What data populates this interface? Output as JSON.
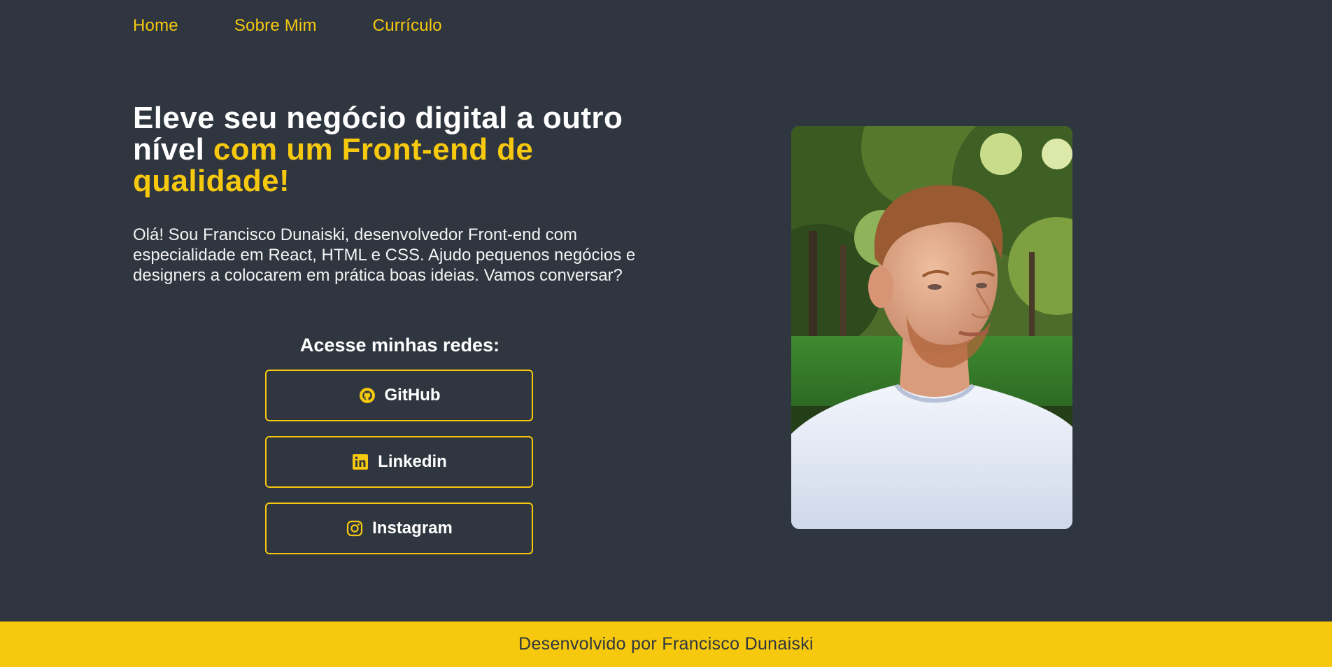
{
  "nav": {
    "items": [
      {
        "label": "Home"
      },
      {
        "label": "Sobre Mim"
      },
      {
        "label": "Currículo"
      }
    ]
  },
  "hero": {
    "title_part1": "Eleve seu negócio digital a outro nível ",
    "title_highlight": "com um Front-end de qualidade!",
    "intro": "Olá! Sou Francisco Dunaiski, desenvolvedor Front-end com especialidade em React, HTML e CSS. Ajudo pequenos negócios e designers a colocarem em prática boas ideias. Vamos conversar?"
  },
  "social": {
    "title": "Acesse minhas redes:",
    "buttons": [
      {
        "label": "GitHub",
        "icon": "github-icon"
      },
      {
        "label": "Linkedin",
        "icon": "linkedin-icon"
      },
      {
        "label": "Instagram",
        "icon": "instagram-icon"
      }
    ]
  },
  "photo": {
    "alt": "portrait-photo"
  },
  "footer": {
    "text": "Desenvolvido por Francisco Dunaiski"
  },
  "colors": {
    "background": "#2f3640",
    "accent": "#f6c90e",
    "text": "#ffffff"
  }
}
